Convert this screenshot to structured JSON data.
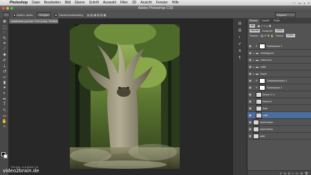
{
  "menubar": {
    "app_name": "Photoshop",
    "items": [
      "Datei",
      "Bearbeiten",
      "Bild",
      "Ebene",
      "Schrift",
      "Auswahl",
      "Filter",
      "3D",
      "Ansicht",
      "Fenster",
      "Hilfe"
    ]
  },
  "window": {
    "title": "Adobe Photoshop CS6"
  },
  "options_bar": {
    "autoselect_label": "Autom. ausw.",
    "autoselect_target": "Gruppe",
    "transform_label": "Transformationsstrg.",
    "workspace": "Eigener Bereich"
  },
  "document_tab": {
    "label": "waldbaum.psd bei 72% (Lintk, RGB/8)"
  },
  "status_bar": {
    "zoom": "72%",
    "doc_info": "Dok: 11,8 M/120,7 M"
  },
  "panel": {
    "tabs": [
      "Ebenen",
      "Kanäle",
      "Pfade"
    ],
    "filter_label": "Art",
    "blend_mode": "Normal",
    "opacity_label": "Deckkraft:",
    "opacity_value": "100%",
    "lock_label": "Fixieren:",
    "fill_label": "Fläche:",
    "fill_value": "100%"
  },
  "layers": [
    {
      "name": "Farbbalance 3",
      "type": "adjustment",
      "indent": 1,
      "selected": false,
      "has_fx": false
    },
    {
      "name": "Vordergrund",
      "type": "group",
      "indent": 0,
      "selected": false,
      "has_fx": false
    },
    {
      "name": "nebel vorn",
      "type": "group",
      "indent": 0,
      "selected": false,
      "has_fx": false
    },
    {
      "name": "mitte",
      "type": "group",
      "indent": 0,
      "selected": false,
      "has_fx": false
    },
    {
      "name": "baum",
      "type": "group",
      "indent": 0,
      "selected": false,
      "has_fx": false
    },
    {
      "name": "Tonwertkorrektur 3",
      "type": "adjustment",
      "indent": 1,
      "selected": false,
      "has_fx": false
    },
    {
      "name": "Farbbalance 1",
      "type": "adjustment",
      "indent": 1,
      "selected": false,
      "has_fx": false
    },
    {
      "name": "Ebene 4",
      "type": "pixel",
      "indent": 1,
      "selected": false,
      "has_fx": true
    },
    {
      "name": "Ebene 5",
      "type": "pixel",
      "indent": 1,
      "selected": false,
      "has_fx": false
    },
    {
      "name": "Äste",
      "type": "pixel",
      "indent": 1,
      "selected": false,
      "has_fx": false
    },
    {
      "name": "Lintk",
      "type": "pixel",
      "indent": 1,
      "selected": true,
      "has_fx": false
    },
    {
      "name": "nebel hinten",
      "type": "pixel",
      "indent": 0,
      "selected": false,
      "has_fx": false
    },
    {
      "name": "nebel hinten",
      "type": "pixel",
      "indent": 0,
      "selected": false,
      "has_fx": false
    },
    {
      "name": "wald",
      "type": "pixel",
      "indent": 0,
      "selected": false,
      "has_fx": false
    }
  ],
  "watermark": {
    "text": "video2brain.de"
  },
  "icons": {
    "eye": "eye-icon",
    "folder": "folder-icon",
    "adjustment": "adjustment-icon"
  },
  "colors": {
    "selected_layer": "#4b6ea0",
    "panel_bg": "#535353",
    "canvas_bg": "#282828"
  }
}
